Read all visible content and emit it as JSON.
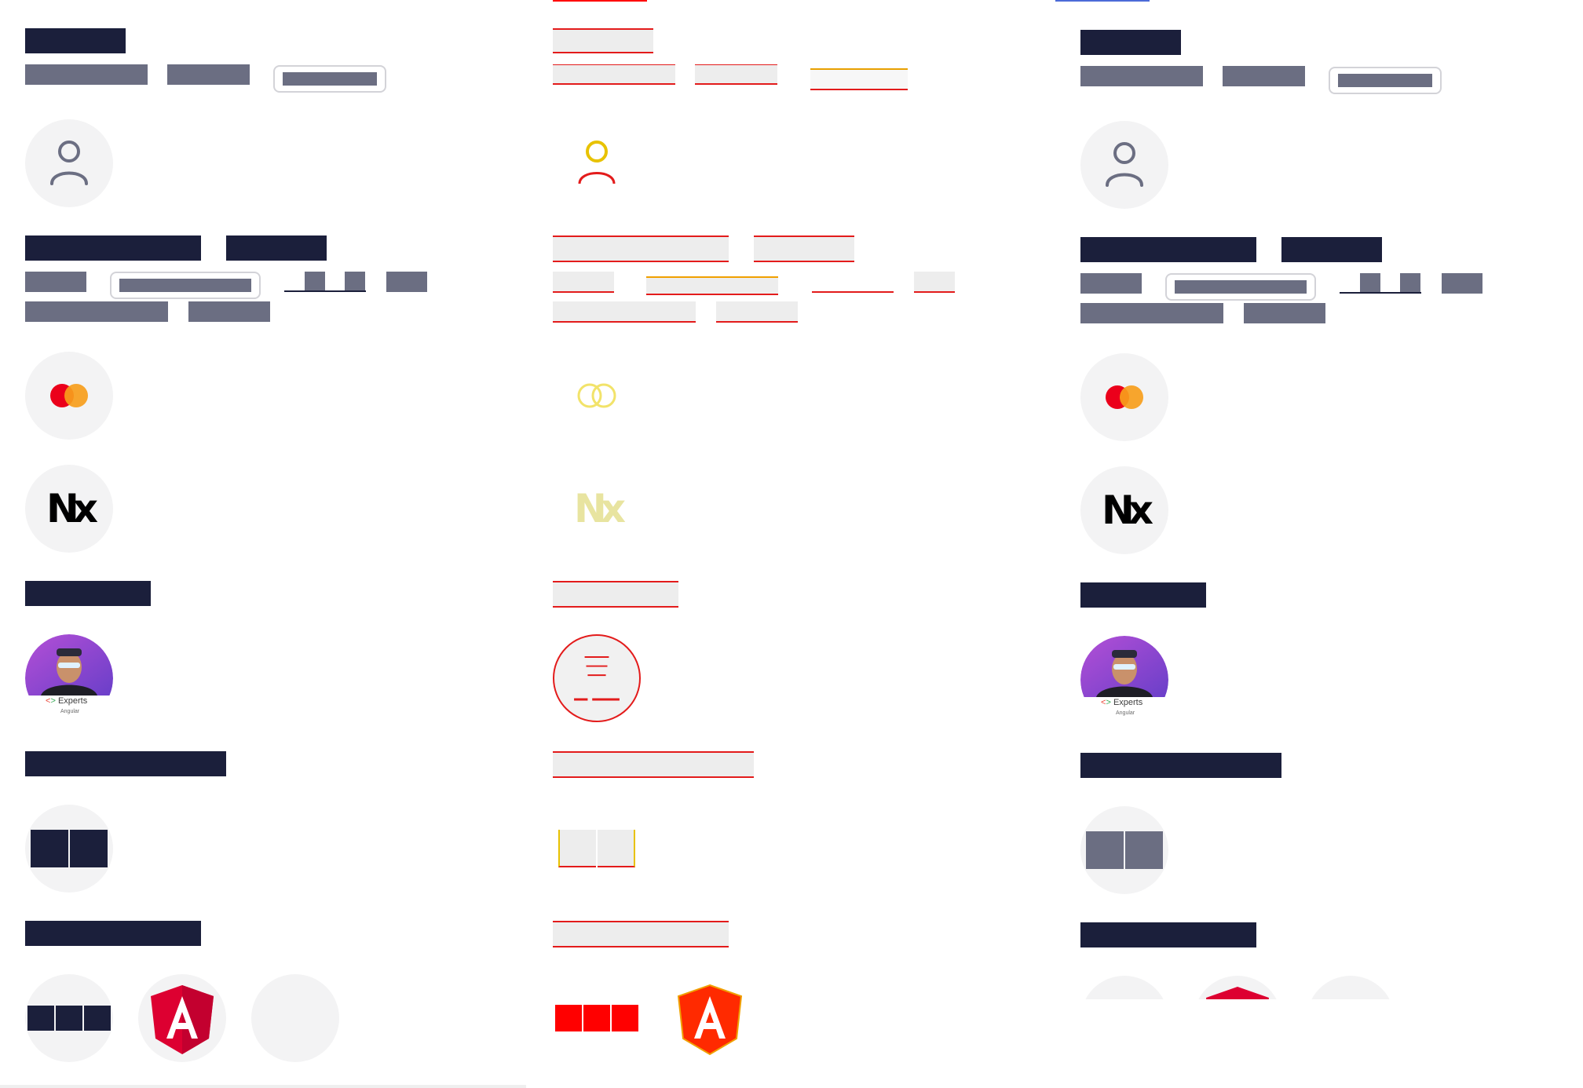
{
  "panels": [
    {
      "id": "left"
    },
    {
      "id": "middle"
    },
    {
      "id": "right"
    }
  ],
  "colors": {
    "heading": "#1b1f3b",
    "text_placeholder": "#6b6e82",
    "circle_bg": "#f3f3f4",
    "diff_red": "#ff0000",
    "mastercard_red": "#eb001b",
    "mastercard_orange": "#f79e1b",
    "angular_red": "#dd0031"
  },
  "icons": {
    "user": "user-icon",
    "mastercard": "mastercard-icon",
    "nx": "nx-logo-icon",
    "avatar": "profile-avatar",
    "angular": "angular-logo-icon"
  },
  "nx_logo_text": "Nx",
  "avatar_badge": {
    "title": "Experts",
    "subtitle": "Angular"
  }
}
